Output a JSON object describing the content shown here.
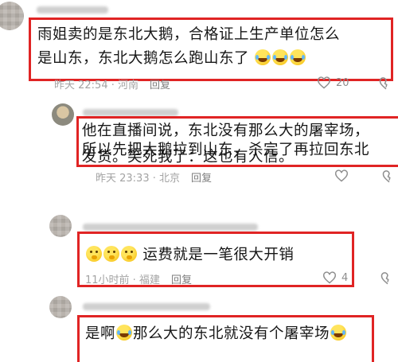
{
  "comments": [
    {
      "text_line1": "雨姐卖的是东北大鹅，合格证上生产单位怎么",
      "text_line2": "是山东，东北大鹅怎么跑山东了",
      "meta": "昨天 22:54 · 河南",
      "reply": "回复",
      "likes": "20"
    },
    {
      "text_line1": "他在直播间说，东北没有那么大的屠宰场，",
      "text_line2": "所以先把大鹅拉到山东，杀完了再拉回东北",
      "text_line3": "发货。笑死我了：这也有人信。",
      "meta": "昨天 23:33 · 北京",
      "reply": "回复"
    },
    {
      "text_line1": "运费就是一笔很大开销",
      "meta": "11小时前 · 福建",
      "reply": "回复",
      "likes": "4"
    },
    {
      "text_line1": "是啊",
      "text_line1b": "那么大的东北就没有个屠宰场"
    }
  ],
  "icons": {
    "like": "heart-outline-icon",
    "dislike": "heart-broken-outline-icon",
    "laugh_emoji": "rolling-laughing-emoji-icon",
    "shush_emoji": "shushing-face-emoji-icon"
  },
  "colors": {
    "highlight": "#e02424",
    "meta": "#a3a3a3"
  }
}
